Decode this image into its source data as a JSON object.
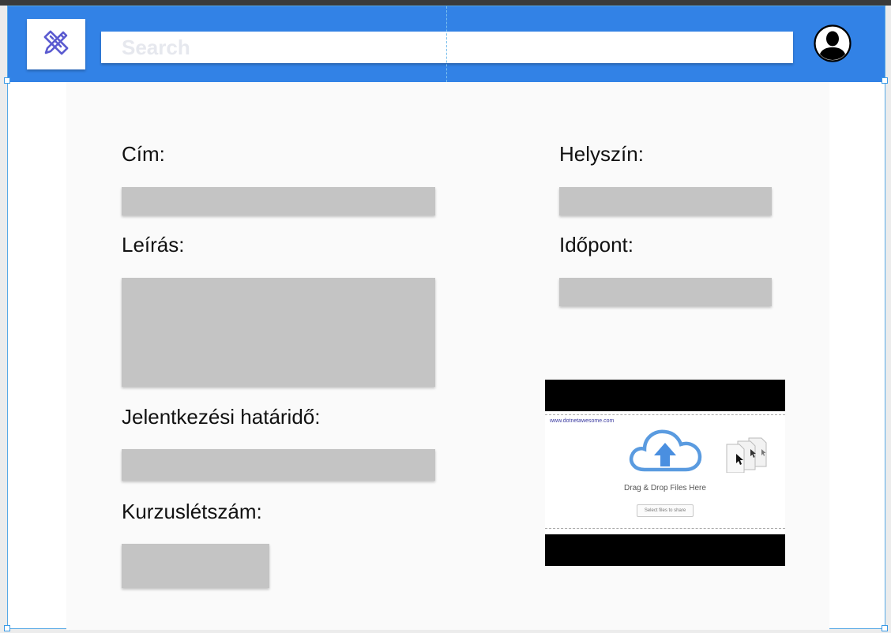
{
  "header": {
    "search_placeholder": "Search"
  },
  "icons": {
    "logo": "pencil-ruler-icon",
    "avatar": "user-avatar-icon",
    "upload": "cloud-upload-icon"
  },
  "colors": {
    "appbar": "#3282e6",
    "field": "#c4c4c4",
    "icon_accent": "#5a5ad0"
  },
  "form": {
    "title_label": "Cím:",
    "description_label": "Leírás:",
    "deadline_label": "Jelentkezési határidő:",
    "capacity_label": "Kurzuslétszám:",
    "location_label": "Helyszín:",
    "time_label": "Időpont:"
  },
  "upload": {
    "site_url": "www.dotnetawesome.com",
    "drop_text": "Drag & Drop Files Here",
    "select_button": "Select files to share"
  }
}
